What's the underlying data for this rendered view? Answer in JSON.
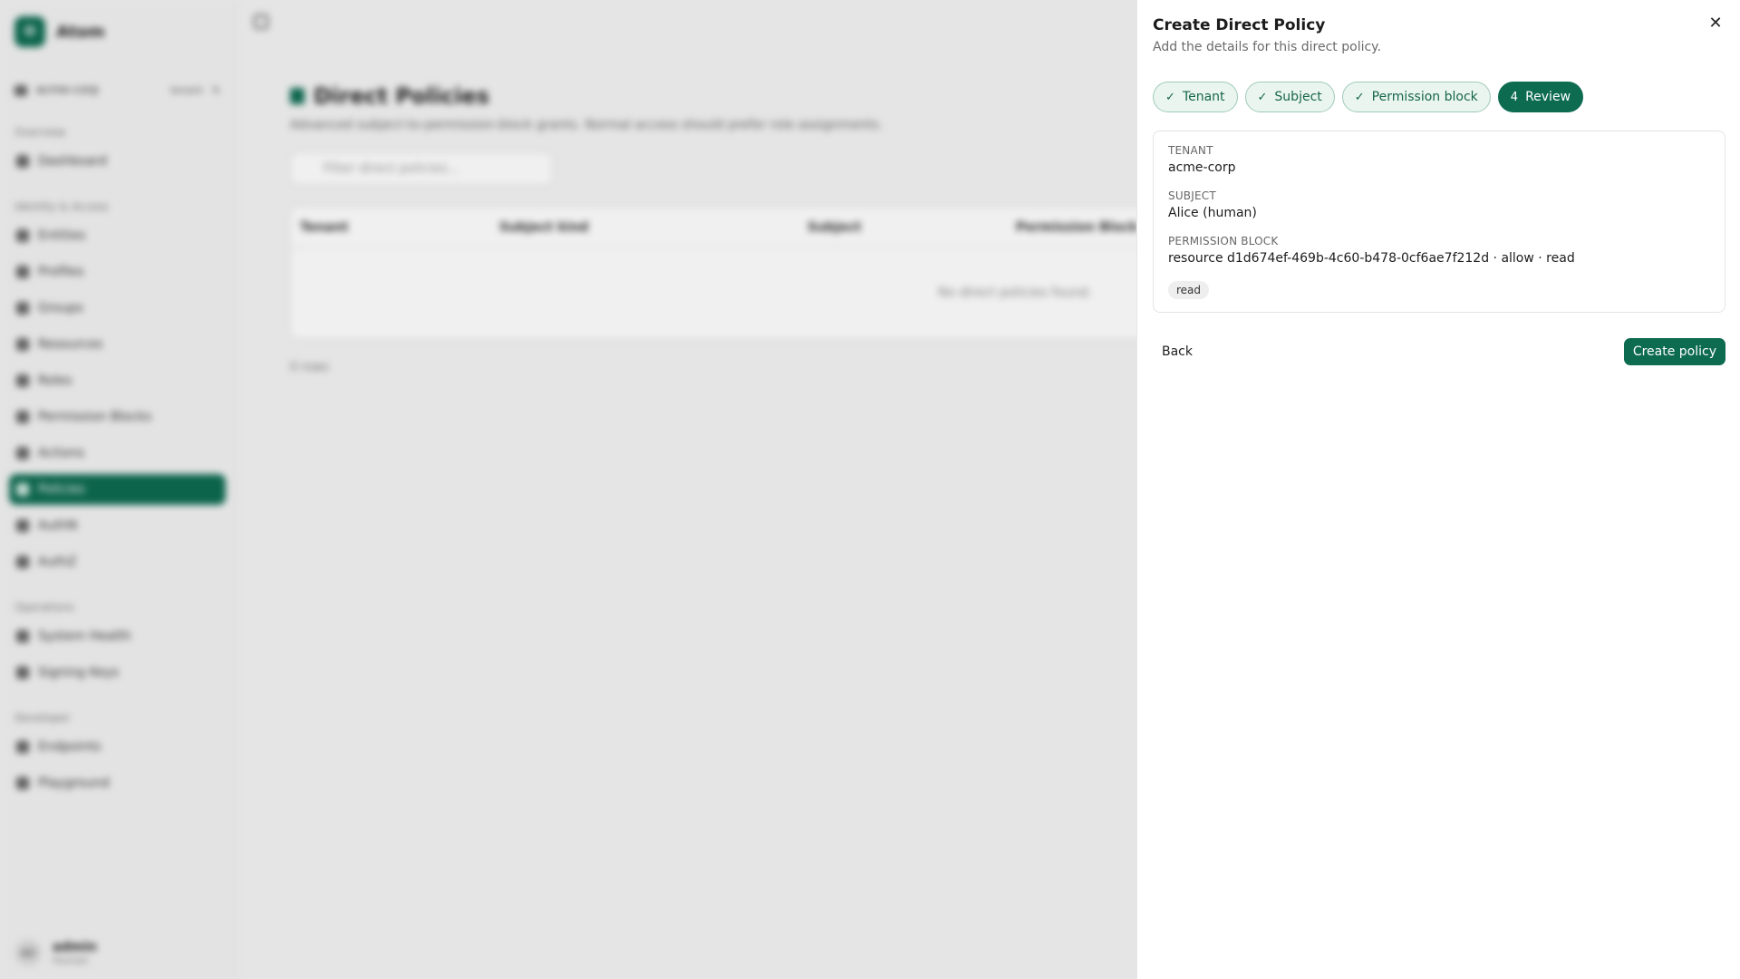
{
  "background": {
    "brand": {
      "logo_letter": "O",
      "name": "Atom"
    },
    "tenant": {
      "name": "acme-corp",
      "tag": "tenant"
    },
    "nav_groups": [
      {
        "label": "Overview",
        "items": [
          {
            "label": "Dashboard",
            "active": false
          }
        ]
      },
      {
        "label": "Identity & Access",
        "items": [
          {
            "label": "Entities",
            "active": false
          },
          {
            "label": "Profiles",
            "active": false
          },
          {
            "label": "Groups",
            "active": false
          },
          {
            "label": "Resources",
            "active": false
          },
          {
            "label": "Roles",
            "active": false
          },
          {
            "label": "Permission Blocks",
            "active": false
          },
          {
            "label": "Actions",
            "active": false
          },
          {
            "label": "Policies",
            "active": true
          },
          {
            "label": "AuthN",
            "active": false
          },
          {
            "label": "AuthZ",
            "active": false
          }
        ]
      },
      {
        "label": "Operations",
        "items": [
          {
            "label": "System Health",
            "active": false
          },
          {
            "label": "Signing Keys",
            "active": false
          }
        ]
      },
      {
        "label": "Developer",
        "items": [
          {
            "label": "Endpoints",
            "active": false
          },
          {
            "label": "Playground",
            "active": false
          }
        ]
      }
    ],
    "user": {
      "avatar": "AD",
      "name": "admin",
      "role": "Human"
    },
    "page": {
      "title": "Direct Policies",
      "subtitle": "Advanced subject-to-permission-block grants. Normal access should prefer role assignments.",
      "filter_placeholder": "Filter direct policies...",
      "columns": [
        "Tenant",
        "Subject kind",
        "Subject",
        "Permission Block"
      ],
      "empty_text": "No direct policies found.",
      "rows_count": "0 rows"
    }
  },
  "drawer": {
    "title": "Create Direct Policy",
    "subtitle": "Add the details for this direct policy.",
    "steps": [
      {
        "label": "Tenant",
        "marker": "✓",
        "state": "done"
      },
      {
        "label": "Subject",
        "marker": "✓",
        "state": "done"
      },
      {
        "label": "Permission block",
        "marker": "✓",
        "state": "done"
      },
      {
        "label": "Review",
        "marker": "4",
        "state": "current"
      }
    ],
    "review": {
      "tenant_label": "TENANT",
      "tenant_value": "acme-corp",
      "subject_label": "SUBJECT",
      "subject_value": "Alice (human)",
      "block_label": "PERMISSION BLOCK",
      "block_value": "resource d1d674ef-469b-4c60-b478-0cf6ae7f212d · allow · read",
      "action_chip": "read"
    },
    "back_label": "Back",
    "create_label": "Create policy",
    "close_icon": "close-icon"
  },
  "colors": {
    "accent": "#0d6b50",
    "step_done_bg": "#eaf5f0",
    "step_done_border": "#9fcab8"
  }
}
